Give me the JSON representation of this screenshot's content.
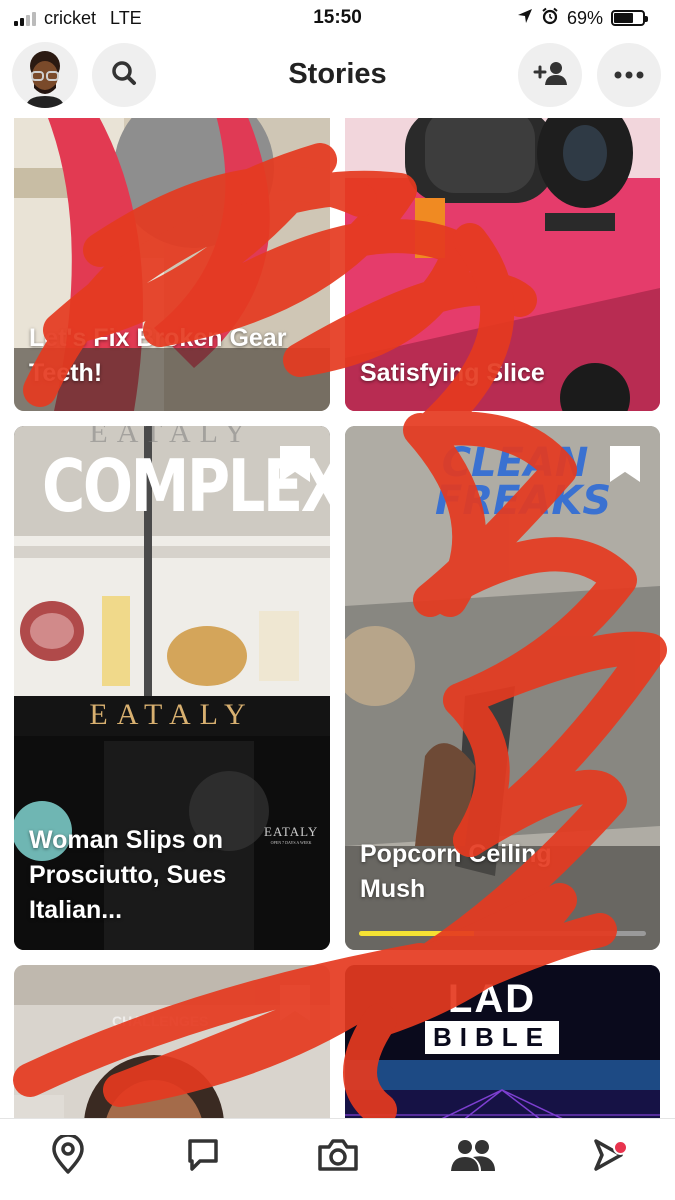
{
  "status": {
    "carrier": "cricket",
    "network": "LTE",
    "time": "15:50",
    "battery": "69%",
    "battery_level": 0.69
  },
  "header": {
    "title": "Stories"
  },
  "icons": {
    "search": "search-icon",
    "add_friend": "add-friend-icon",
    "more": "more-icon",
    "map": "map-pin-icon",
    "chat": "chat-icon",
    "camera": "camera-icon",
    "friends": "friends-icon",
    "discover": "play-icon"
  },
  "stories": [
    {
      "title": "Let's Fix Broken Gear Teeth!"
    },
    {
      "title": "Satisfying Slice"
    },
    {
      "title": "Woman Slips on Prosciutto, Sues Italian...",
      "publisher": "COMPLEX",
      "sign": "EATALY",
      "sign_top": "EATALY",
      "door_sign": "EATALY",
      "door_hours": "OPEN 7 DAYS A WEEK"
    },
    {
      "title": "Popcorn Ceiling Mush",
      "publisher": "CLEAN FREAKS",
      "progress": 0.4
    },
    {
      "title": "",
      "publisher": "CHALLENGES"
    },
    {
      "title": "",
      "publisher_top": "LAD",
      "publisher_bottom": "BIBLE"
    }
  ],
  "colors": {
    "accent_red": "#e8344e",
    "scribble": "#e53a20",
    "progress": "#f5e233"
  }
}
